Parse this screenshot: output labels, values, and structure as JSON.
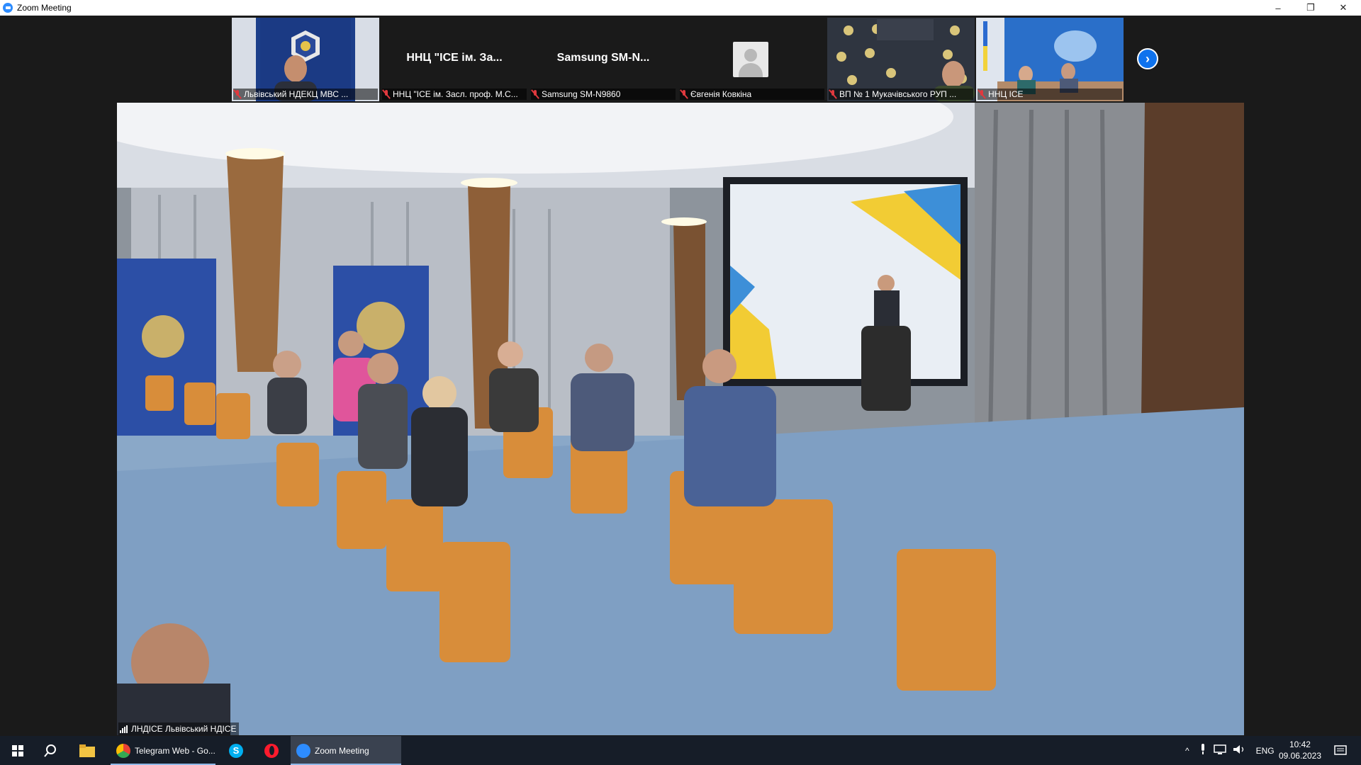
{
  "window": {
    "title": "Zoom Meeting",
    "controls": {
      "minimize": "–",
      "restore": "❐",
      "close": "✕"
    }
  },
  "participants": [
    {
      "label": "Львівський НДЕКЦ МВС ...",
      "center_name": "",
      "muted": true,
      "type": "video"
    },
    {
      "label": "ННЦ \"ІСЕ ім. Засл. проф. М.С...",
      "center_name": "ННЦ  \"ІСЕ ім. За...",
      "muted": true,
      "type": "name"
    },
    {
      "label": "Samsung SM-N9860",
      "center_name": "Samsung  SM-N...",
      "muted": true,
      "type": "name"
    },
    {
      "label": "Євгенія Ковкіна",
      "center_name": "",
      "muted": true,
      "type": "avatar"
    },
    {
      "label": "ВП № 1 Мукачівського РУП ...",
      "center_name": "",
      "muted": true,
      "type": "video"
    },
    {
      "label": "ННЦ ІСЕ",
      "center_name": "",
      "muted": true,
      "type": "video"
    }
  ],
  "next_page_icon": "chevron-right-icon",
  "main_video": {
    "speaker_label": "ЛНДІСЕ Львівський НДІСЕ"
  },
  "taskbar": {
    "apps": [
      {
        "name": "Telegram Web - Go...",
        "icon": "chrome-icon",
        "active": false
      },
      {
        "name": "Zoom Meeting",
        "icon": "zoom-icon",
        "active": true
      }
    ],
    "language": "ENG",
    "time": "10:42",
    "date": "09.06.2023"
  },
  "colors": {
    "zoom_blue": "#0e72ed",
    "muted_red": "#e0393e",
    "taskbar_bg": "#161d28"
  }
}
